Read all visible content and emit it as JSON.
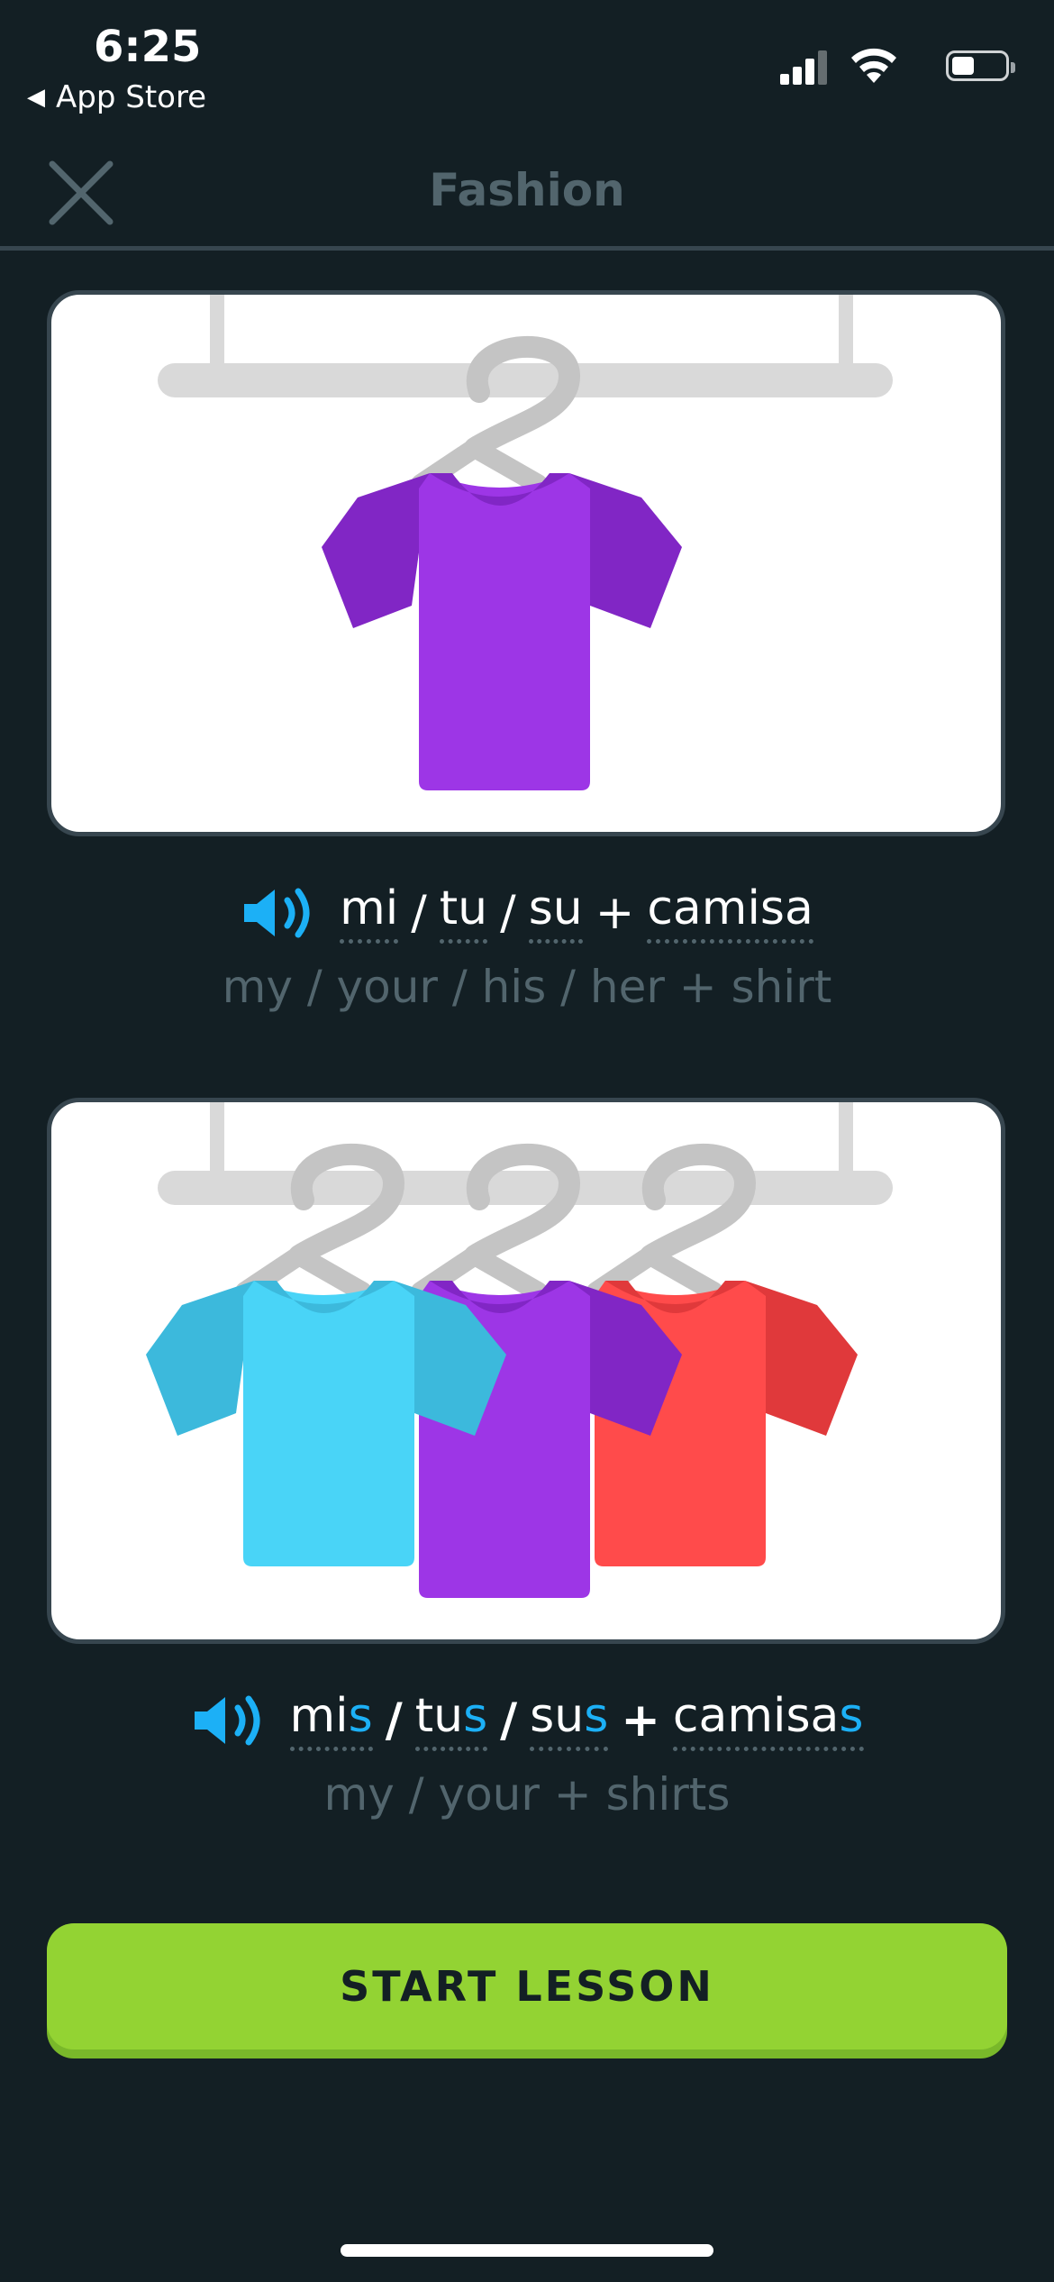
{
  "status_bar": {
    "time": "6:25",
    "back_label": "App Store"
  },
  "header": {
    "title": "Fashion",
    "close_icon": "close-icon"
  },
  "cards": [
    {
      "image": "purple-shirt-on-hanger",
      "phrase": {
        "words": [
          "mi",
          "tu",
          "su",
          "camisa"
        ],
        "separators": [
          "/",
          "/",
          "+"
        ]
      },
      "translation": "my / your / his / her + shirt"
    },
    {
      "image": "three-shirts-on-hangers",
      "phrase": {
        "words": [
          {
            "stem": "mi",
            "suffix": "s"
          },
          {
            "stem": "tu",
            "suffix": "s"
          },
          {
            "stem": "su",
            "suffix": "s"
          },
          {
            "stem": "camisa",
            "suffix": "s"
          }
        ],
        "separators": [
          "/",
          "/",
          "+"
        ]
      },
      "translation": "my / your + shirts"
    }
  ],
  "button": {
    "label": "START LESSON"
  },
  "colors": {
    "background": "#131f24",
    "accent_blue": "#1cb0f6",
    "button_green": "#93d333",
    "muted_text": "#52656d"
  }
}
